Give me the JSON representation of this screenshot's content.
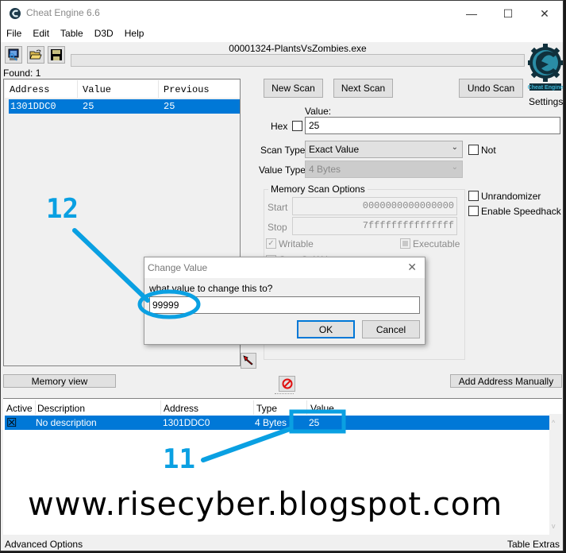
{
  "window": {
    "title": "Cheat Engine 6.6",
    "minimize": "—",
    "maximize": "☐",
    "close": "✕"
  },
  "menu": [
    "File",
    "Edit",
    "Table",
    "D3D",
    "Help"
  ],
  "toolbar": {
    "icons": [
      "open-process-icon",
      "open-file-icon",
      "save-icon"
    ]
  },
  "process": {
    "name": "00001324-PlantsVsZombies.exe",
    "progress": 0
  },
  "found": "Found: 1",
  "scan_results": {
    "columns": [
      "Address",
      "Value",
      "Previous"
    ],
    "rows": [
      {
        "address": "1301DDC0",
        "value": "25",
        "previous": "25"
      }
    ]
  },
  "scan_buttons": {
    "new_scan": "New Scan",
    "next_scan": "Next Scan",
    "undo_scan": "Undo Scan"
  },
  "settings_label": "Settings",
  "logo_text": "Cheat Engine",
  "value_section": {
    "value_label": "Value:",
    "hex_label": "Hex",
    "value": "25",
    "scan_type_label": "Scan Type",
    "scan_type": "Exact Value",
    "not_label": "Not",
    "value_type_label": "Value Type",
    "value_type": "4 Bytes"
  },
  "memory_scan_options": {
    "title": "Memory Scan Options",
    "start_label": "Start",
    "start_value": "0000000000000000",
    "stop_label": "Stop",
    "stop_value": "7fffffffffffffff",
    "writable_label": "Writable",
    "executable_label": "Executable",
    "copy_on_write_label": "CopyOnWrite"
  },
  "right_options": {
    "unrandomizer": "Unrandomizer",
    "speedhack": "Enable Speedhack"
  },
  "dialog": {
    "title": "Change Value",
    "prompt": "what value to change this to?",
    "input_value": "99999",
    "ok": "OK",
    "cancel": "Cancel"
  },
  "memory_view_button": "Memory view",
  "add_address_button": "Add Address Manually",
  "address_list": {
    "columns": [
      "Active",
      "Description",
      "Address",
      "Type",
      "Value"
    ],
    "rows": [
      {
        "active": "☒",
        "description": "No description",
        "address": "1301DDC0",
        "type": "4 Bytes",
        "value": "25"
      }
    ]
  },
  "statusbar": {
    "left": "Advanced Options",
    "right": "Table Extras"
  },
  "annotations": {
    "step_12": "12",
    "step_11": "11",
    "color": "#0aa0e2"
  },
  "watermark": "www.risecyber.blogspot.com"
}
